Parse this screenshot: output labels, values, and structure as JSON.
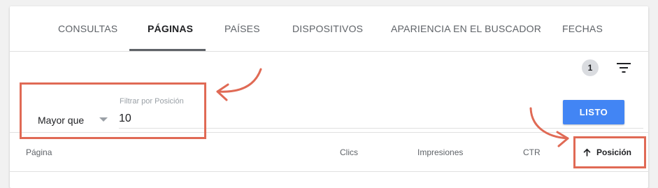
{
  "tabs": [
    {
      "label": "CONSULTAS",
      "active": false
    },
    {
      "label": "PÁGINAS",
      "active": true
    },
    {
      "label": "PAÍSES",
      "active": false
    },
    {
      "label": "DISPOSITIVOS",
      "active": false
    },
    {
      "label": "APARIENCIA EN EL BUSCADOR",
      "active": false
    },
    {
      "label": "FECHAS",
      "active": false
    }
  ],
  "filter_count": "1",
  "filter": {
    "operator": "Mayor que",
    "field_label": "Filtrar por Posición",
    "value": "10",
    "submit_label": "LISTO"
  },
  "table": {
    "columns": [
      "Página",
      "Clics",
      "Impresiones",
      "CTR",
      "Posición"
    ],
    "sorted_column": "Posición",
    "sort_direction": "ascending"
  },
  "colors": {
    "accent": "#4285f4",
    "annotation": "#e06a55",
    "active_tab": "#5f6368",
    "badge": "#dadce0"
  },
  "icons": [
    "filter-icon",
    "arrow-up-icon",
    "dropdown-arrow-icon"
  ]
}
